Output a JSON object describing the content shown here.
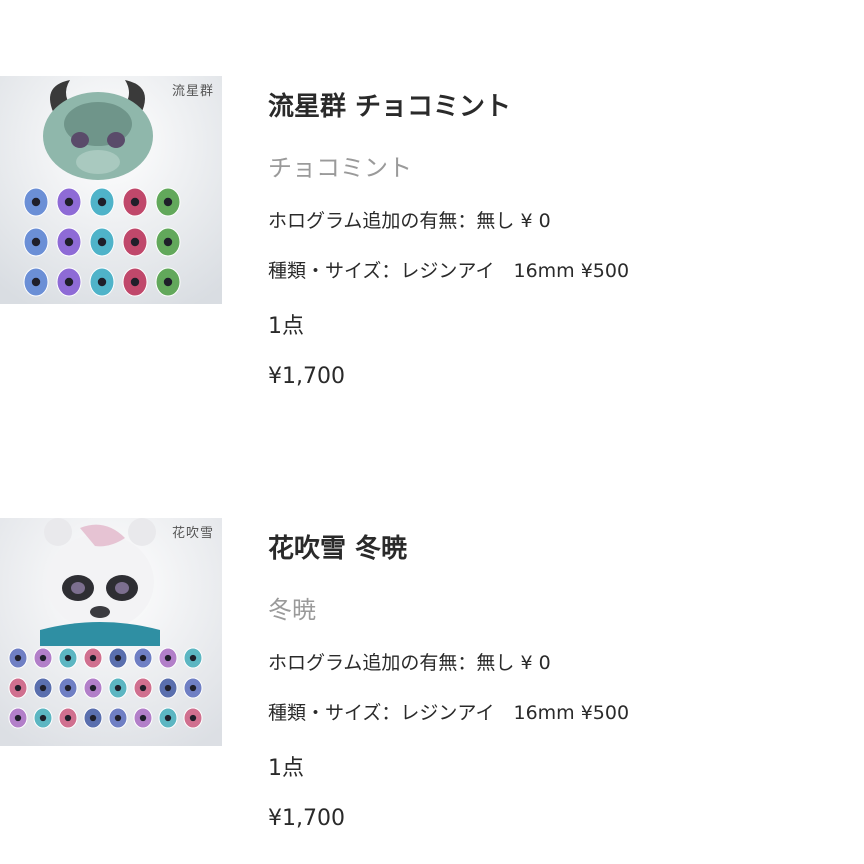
{
  "cart": {
    "items": [
      {
        "thumb_label": "流星群",
        "title": "流星群 チョコミント",
        "variant": "チョコミント",
        "options": [
          "ホログラム追加の有無：無し ¥ 0",
          "種類・サイズ：レジンアイ　16mm ¥500"
        ],
        "quantity": "1点",
        "price": "¥1,700",
        "accent_colors": [
          "#6b8fd6",
          "#8e6bd6",
          "#4fb3c9",
          "#c0486b",
          "#62a85b"
        ]
      },
      {
        "thumb_label": "花吹雪",
        "title": "花吹雪 冬暁",
        "variant": "冬暁",
        "options": [
          "ホログラム追加の有無：無し ¥ 0",
          "種類・サイズ：レジンアイ　16mm ¥500"
        ],
        "quantity": "1点",
        "price": "¥1,700",
        "accent_colors": [
          "#6f7fc4",
          "#b27fc9",
          "#5cb6c2",
          "#d0708f",
          "#5a6fae"
        ]
      }
    ]
  }
}
